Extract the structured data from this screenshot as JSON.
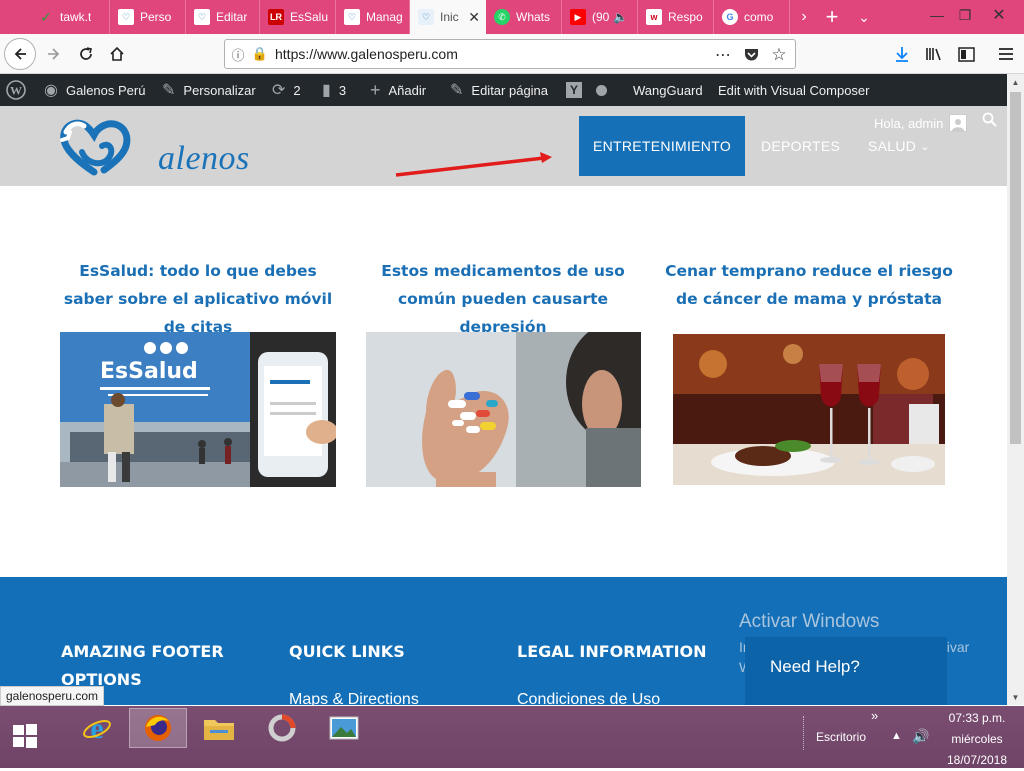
{
  "browser": {
    "tabs": [
      {
        "label": "tawk.t",
        "icon": "tawk-icon"
      },
      {
        "label": "Perso",
        "icon": "galenos-icon"
      },
      {
        "label": "Editar",
        "icon": "galenos-icon"
      },
      {
        "label": "EsSalu",
        "icon": "lr-icon"
      },
      {
        "label": "Manag",
        "icon": "galenos-icon"
      },
      {
        "label": "Inic",
        "icon": "galenos-icon",
        "active": true
      },
      {
        "label": "Whats",
        "icon": "whatsapp-icon"
      },
      {
        "label": "(90",
        "icon": "youtube-icon"
      },
      {
        "label": "Respo",
        "icon": "w-icon"
      },
      {
        "label": "como",
        "icon": "google-icon"
      }
    ],
    "lr_badge": "LR",
    "url": "https://www.galenosperu.com",
    "status_url": "galenosperu.com",
    "colors": {
      "tabstrip": "#e0457b",
      "accent": "#1570b8"
    }
  },
  "adminbar": {
    "site_name": "Galenos Perú",
    "customize": "Personalizar",
    "updates": "2",
    "comments": "3",
    "add_new": "Añadir",
    "edit_page": "Editar página",
    "wangguard": "WangGuard",
    "visual_composer": "Edit with Visual Composer"
  },
  "header": {
    "logo_text": "alenos",
    "nav": {
      "entretenimiento": "ENTRETENIMIENTO",
      "deportes": "DEPORTES",
      "salud": "SALUD"
    },
    "greeting": "Hola, admin"
  },
  "articles": [
    {
      "title": "EsSalud: todo lo que debes saber sobre el aplicativo móvil de citas",
      "sign": "EsSalud"
    },
    {
      "title": "Estos medicamentos de uso común pueden causarte depresión"
    },
    {
      "title": "Cenar temprano reduce el riesgo de cáncer de mama y próstata"
    }
  ],
  "footer": {
    "col1_title": "AMAZING FOOTER OPTIONS",
    "col2_title": "QUICK LINKS",
    "col3_title": "LEGAL INFORMATION",
    "col2_link": "Maps & Directions",
    "col3_link": "Condiciones de Uso",
    "activate_title": "Activar Windows",
    "activate_sub": "Ir a Configuración de PC para activar Windows.",
    "need_help": "Need Help?"
  },
  "taskbar": {
    "desktop_label": "Escritorio",
    "time": "07:33 p.m.",
    "day": "miércoles",
    "date": "18/07/2018"
  }
}
